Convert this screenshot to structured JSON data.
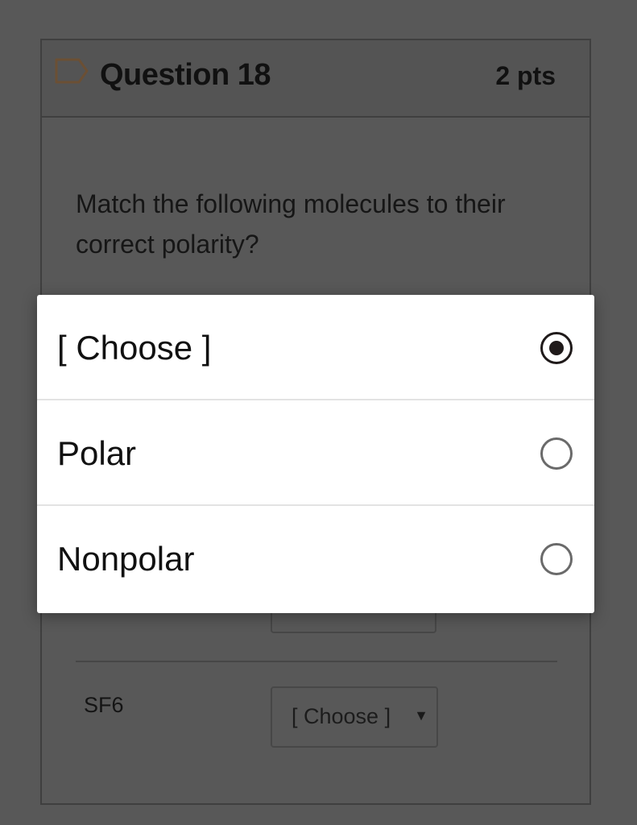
{
  "question": {
    "title": "Question 18",
    "points": "2 pts",
    "prompt": "Match the following molecules to their correct polarity?",
    "flag_icon": "flag-outline-icon"
  },
  "rows": [
    {
      "label": "SF6",
      "selected": "[ Choose ]"
    }
  ],
  "dropdown": {
    "options": [
      {
        "label": "[ Choose ]",
        "checked": true
      },
      {
        "label": "Polar",
        "checked": false
      },
      {
        "label": "Nonpolar",
        "checked": false
      }
    ],
    "arrow_icon": "triangle-down-icon"
  },
  "colors": {
    "backdrop": "#585858",
    "dialog": "#ffffff",
    "radio_checked": "#1f1a1a",
    "radio_unchecked": "#6a6a6a",
    "flag_outline": "#6b4f34"
  }
}
